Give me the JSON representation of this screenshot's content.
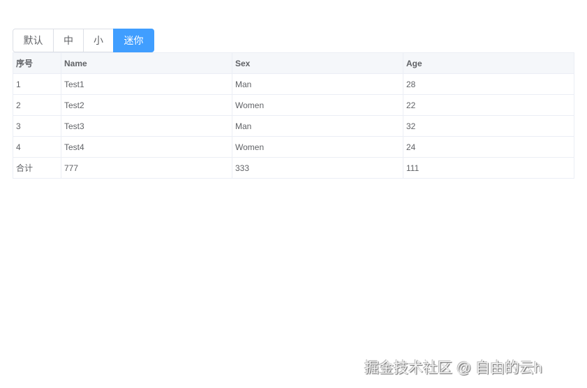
{
  "size_buttons": [
    {
      "label": "默认",
      "active": false
    },
    {
      "label": "中",
      "active": false
    },
    {
      "label": "小",
      "active": false
    },
    {
      "label": "迷你",
      "active": true
    }
  ],
  "table": {
    "headers": [
      "序号",
      "Name",
      "Sex",
      "Age"
    ],
    "rows": [
      [
        "1",
        "Test1",
        "Man",
        "28"
      ],
      [
        "2",
        "Test2",
        "Women",
        "22"
      ],
      [
        "3",
        "Test3",
        "Man",
        "32"
      ],
      [
        "4",
        "Test4",
        "Women",
        "24"
      ]
    ],
    "footer": [
      "合计",
      "777",
      "333",
      "111"
    ]
  },
  "watermark": "掘金技术社区 @ 自由的云h",
  "colors": {
    "accent": "#409eff"
  }
}
